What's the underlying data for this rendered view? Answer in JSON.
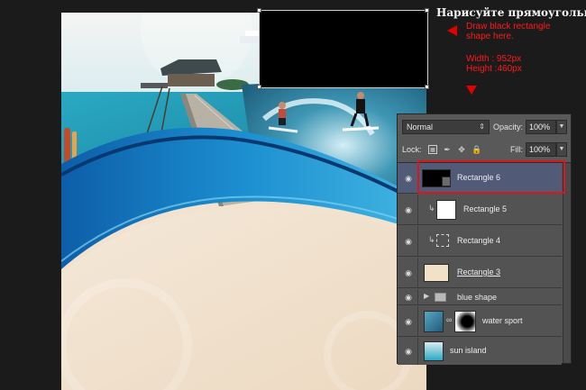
{
  "annotation": {
    "title": "Нарисуйте прямоугольник",
    "instruction_line1": "Draw black rectangle",
    "instruction_line2": "shape here.",
    "width_text": "Width : 952px",
    "height_text": "Height :460px",
    "accent_color": "#ff1a1a"
  },
  "layers_panel": {
    "blend_mode": "Normal",
    "opacity_label": "Opacity:",
    "opacity_value": "100%",
    "lock_label": "Lock:",
    "fill_label": "Fill:",
    "fill_value": "100%",
    "lock_icons": [
      "lock-transparent-icon",
      "lock-brush-icon",
      "lock-move-icon",
      "lock-all-icon"
    ],
    "selected_color": "#515a77",
    "layers": [
      {
        "name": "Rectangle 6",
        "selected": true,
        "clipped": false,
        "type": "shape"
      },
      {
        "name": "Rectangle 5",
        "selected": false,
        "clipped": true,
        "type": "shape"
      },
      {
        "name": "Rectangle 4",
        "selected": false,
        "clipped": true,
        "type": "shape"
      },
      {
        "name": "Rectangle 3",
        "selected": false,
        "clipped": false,
        "type": "shape"
      },
      {
        "name": "blue shape",
        "selected": false,
        "clipped": false,
        "type": "group"
      },
      {
        "name": "water sport",
        "selected": false,
        "clipped": false,
        "type": "masked"
      },
      {
        "name": "sun island",
        "selected": false,
        "clipped": false,
        "type": "smart-object"
      }
    ]
  }
}
